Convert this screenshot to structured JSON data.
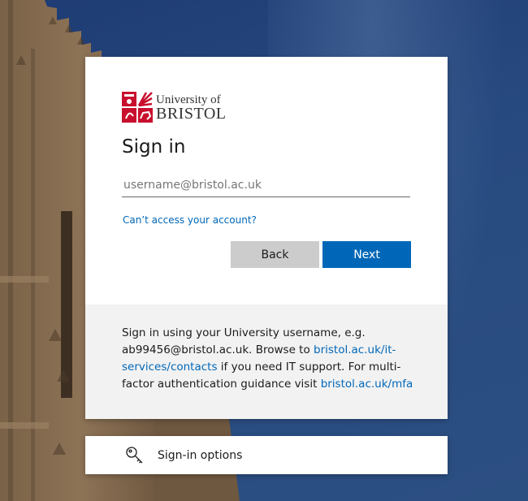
{
  "branding": {
    "logo_line1": "University of",
    "logo_line2": "BRISTOL",
    "brand_red": "#c8102e"
  },
  "signin": {
    "title": "Sign in",
    "email_placeholder": "username@bristol.ac.uk",
    "email_value": "",
    "cant_access_link": "Can’t access your account?",
    "back_label": "Back",
    "next_label": "Next"
  },
  "footer": {
    "text_1": "Sign in using your University username, e.g. ab99456@bristol.ac.uk. Browse to ",
    "link_1": "bristol.ac.uk/it-services/contacts",
    "text_2": " if you need IT support. For multi-factor authentication guidance visit ",
    "link_2": "bristol.ac.uk/mfa"
  },
  "options": {
    "label": "Sign-in options",
    "icon": "key-icon"
  },
  "colors": {
    "accent": "#0067b8",
    "back_button": "#cccccc",
    "footer_bg": "#f2f2f2"
  }
}
